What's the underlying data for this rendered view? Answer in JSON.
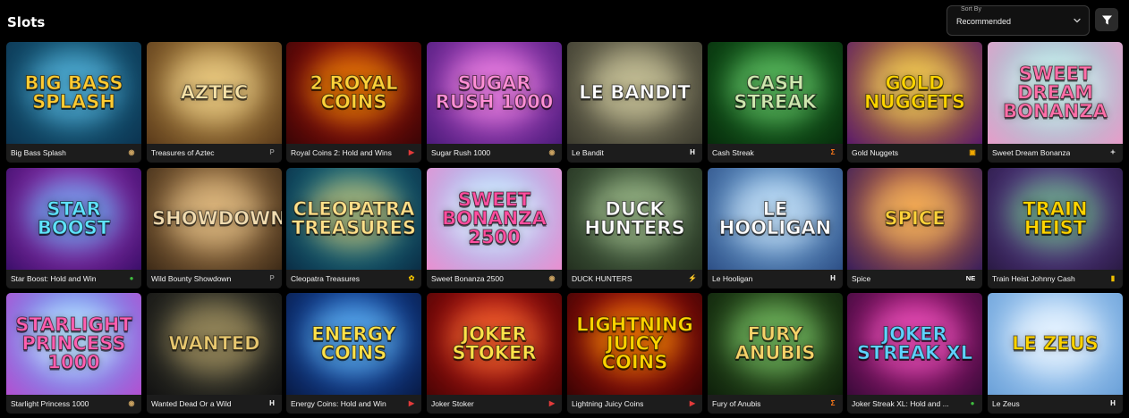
{
  "header": {
    "title": "Slots"
  },
  "sort": {
    "label": "Sort By",
    "value": "Recommended"
  },
  "icons": {
    "sort_chevron": "chevron-down-icon",
    "filter": "filter-icon"
  },
  "games": [
    {
      "name": "Big Bass Splash",
      "art": "Big Bass Splash",
      "bg1": "#1d6f8f",
      "bg2": "#0b3350",
      "glow": "#6fd3ff",
      "art_color": "#ffcc33",
      "prov_color": "#c8a060",
      "prov_glyph": "◉"
    },
    {
      "name": "Treasures of Aztec",
      "art": "Aztec",
      "bg1": "#c59a4d",
      "bg2": "#5a3a1a",
      "glow": "#ffe6a0",
      "art_color": "#f6e2a8",
      "prov_color": "#888888",
      "prov_glyph": "P"
    },
    {
      "name": "Royal Coins 2: Hold and Wins",
      "art": "2 Royal Coins",
      "bg1": "#b3120f",
      "bg2": "#3a0505",
      "glow": "#ffb300",
      "art_color": "#ffd23a",
      "prov_color": "#e23a3a",
      "prov_glyph": "▶"
    },
    {
      "name": "Sugar Rush 1000",
      "art": "Sugar Rush 1000",
      "bg1": "#c14fd0",
      "bg2": "#4b1b7a",
      "glow": "#ff9ae8",
      "art_color": "#ff8fd6",
      "prov_color": "#c8a060",
      "prov_glyph": "◉"
    },
    {
      "name": "Le Bandit",
      "art": "Le Bandit",
      "bg1": "#8f8a6c",
      "bg2": "#3b3a2e",
      "glow": "#e6e0b0",
      "art_color": "#ffffff",
      "prov_color": "#ffffff",
      "prov_glyph": "H"
    },
    {
      "name": "Cash Streak",
      "art": "Cash Streak",
      "bg1": "#1f7a2a",
      "bg2": "#062b0b",
      "glow": "#7ee07e",
      "art_color": "#cfe8b0",
      "prov_color": "#ff7a1a",
      "prov_glyph": "Σ"
    },
    {
      "name": "Gold Nuggets",
      "art": "Gold Nuggets",
      "bg1": "#d8a019",
      "bg2": "#5a1a6a",
      "glow": "#ffe27a",
      "art_color": "#ffd400",
      "prov_color": "#f0a800",
      "prov_glyph": "▣"
    },
    {
      "name": "Sweet Dream Bonanza",
      "art": "Sweet Dream Bonanza",
      "bg1": "#7fe0d8",
      "bg2": "#e79cc9",
      "glow": "#ffffff",
      "art_color": "#ff6fa8",
      "prov_color": "#bbbbbb",
      "prov_glyph": "✦"
    },
    {
      "name": "Star Boost: Hold and Win",
      "art": "Star Boost",
      "bg1": "#b23ac8",
      "bg2": "#3b0f6a",
      "glow": "#4fd8ff",
      "art_color": "#5fe3ff",
      "prov_color": "#3fbf3f",
      "prov_glyph": "●"
    },
    {
      "name": "Wild Bounty Showdown",
      "art": "Showdown",
      "bg1": "#b88a52",
      "bg2": "#3d2a17",
      "glow": "#f3d39a",
      "art_color": "#f2dcb0",
      "prov_color": "#888888",
      "prov_glyph": "P"
    },
    {
      "name": "Cleopatra Treasures",
      "art": "Cleopatra Treasures",
      "bg1": "#1e8a9a",
      "bg2": "#0b2d45",
      "glow": "#ffd166",
      "art_color": "#ffe08a",
      "prov_color": "#f0c000",
      "prov_glyph": "✿"
    },
    {
      "name": "Sweet Bonanza 2500",
      "art": "Sweet Bonanza 2500",
      "bg1": "#8fd3ff",
      "bg2": "#e98fd0",
      "glow": "#ffffff",
      "art_color": "#ff4fa0",
      "prov_color": "#c8a060",
      "prov_glyph": "◉"
    },
    {
      "name": "DUCK HUNTERS",
      "art": "Duck Hunters",
      "bg1": "#5a7a55",
      "bg2": "#23301f",
      "glow": "#b9d4a0",
      "art_color": "#ffffff",
      "prov_color": "#ffd400",
      "prov_glyph": "⚡"
    },
    {
      "name": "Le Hooligan",
      "art": "Le Hooligan",
      "bg1": "#7fb8e8",
      "bg2": "#2d4f86",
      "glow": "#e6f4ff",
      "art_color": "#ffffff",
      "prov_color": "#ffffff",
      "prov_glyph": "H"
    },
    {
      "name": "Spice",
      "art": "Spice",
      "bg1": "#e07a3a",
      "bg2": "#3a1e5a",
      "glow": "#ffcf6a",
      "art_color": "#ffd23a",
      "prov_color": "#ffffff",
      "prov_glyph": "NE"
    },
    {
      "name": "Train Heist Johnny Cash",
      "art": "Train Heist",
      "bg1": "#6a4aa8",
      "bg2": "#2a1a44",
      "glow": "#6fe07a",
      "art_color": "#ffd400",
      "prov_color": "#f0c000",
      "prov_glyph": "▮"
    },
    {
      "name": "Starlight Princess 1000",
      "art": "Starlight Princess 1000",
      "bg1": "#4fb6ff",
      "bg2": "#b34fd0",
      "glow": "#ffffff",
      "art_color": "#ff5fb0",
      "prov_color": "#c8a060",
      "prov_glyph": "◉"
    },
    {
      "name": "Wanted Dead Or a Wild",
      "art": "Wanted",
      "bg1": "#4a4a3a",
      "bg2": "#111111",
      "glow": "#c8b070",
      "art_color": "#e8c870",
      "prov_color": "#ffffff",
      "prov_glyph": "H"
    },
    {
      "name": "Energy Coins: Hold and Win",
      "art": "Energy Coins",
      "bg1": "#1b5fd0",
      "bg2": "#081a45",
      "glow": "#7fd8ff",
      "art_color": "#ffe24a",
      "prov_color": "#e23a3a",
      "prov_glyph": "▶"
    },
    {
      "name": "Joker Stoker",
      "art": "Joker Stoker",
      "bg1": "#d11515",
      "bg2": "#4a0404",
      "glow": "#ff8a3a",
      "art_color": "#ffe24a",
      "prov_color": "#e23a3a",
      "prov_glyph": "▶"
    },
    {
      "name": "Lightning Juicy Coins",
      "art": "Lightning Juicy Coins",
      "bg1": "#c8140f",
      "bg2": "#3a0303",
      "glow": "#ffb000",
      "art_color": "#ffd400",
      "prov_color": "#e23a3a",
      "prov_glyph": "▶"
    },
    {
      "name": "Fury of Anubis",
      "art": "Fury Anubis",
      "bg1": "#3a6a2a",
      "bg2": "#0d1f0a",
      "glow": "#8fe07a",
      "art_color": "#f6d36a",
      "prov_color": "#ff7a1a",
      "prov_glyph": "Σ"
    },
    {
      "name": "Joker Streak XL: Hold and ...",
      "art": "Joker Streak XL",
      "bg1": "#c01f8a",
      "bg2": "#3a0a3a",
      "glow": "#ff6ad0",
      "art_color": "#5fd3ff",
      "prov_color": "#3fbf3f",
      "prov_glyph": "●"
    },
    {
      "name": "Le Zeus",
      "art": "Le Zeus",
      "bg1": "#bfe0ff",
      "bg2": "#6aa0d8",
      "glow": "#ffffff",
      "art_color": "#ffd400",
      "prov_color": "#ffffff",
      "prov_glyph": "H"
    }
  ]
}
